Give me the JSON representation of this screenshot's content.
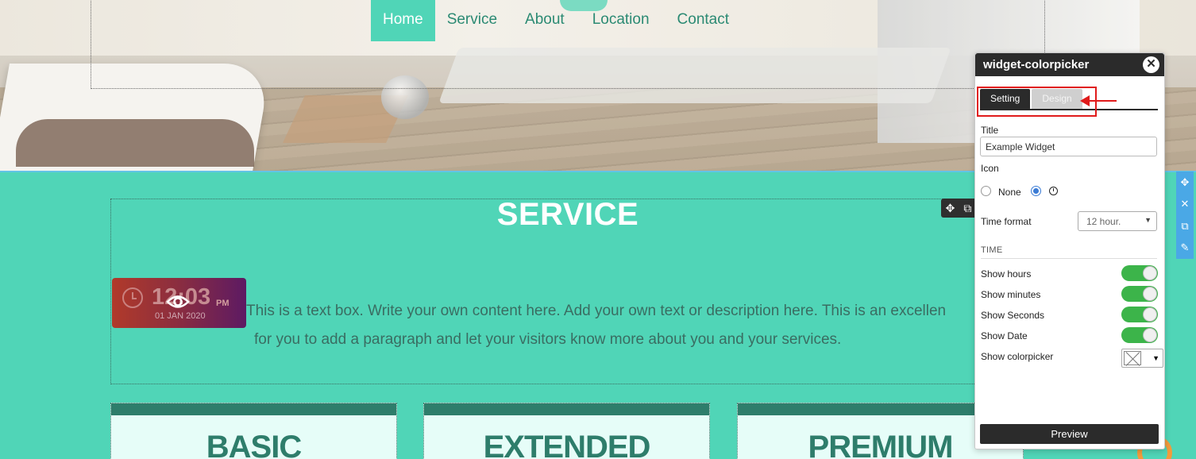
{
  "nav": {
    "items": [
      "Home",
      "Service",
      "About",
      "Location",
      "Contact"
    ],
    "active": "Home"
  },
  "service": {
    "title": "SERVICE",
    "text_line1": "This is a text box. Write your own content here. Add your own text or description here. This is an excellen",
    "text_line2": "for you to add a paragraph and let your visitors know more about you and your services."
  },
  "clock_widget": {
    "time": "12:03",
    "ampm": "PM",
    "date": "01 JAN 2020"
  },
  "cards": [
    {
      "name": "BASIC"
    },
    {
      "name": "EXTENDED"
    },
    {
      "name": "PREMIUM"
    }
  ],
  "panel": {
    "title": "widget-colorpicker",
    "close": "✕",
    "tabs": {
      "setting": "Setting",
      "design": "Design"
    },
    "title_label": "Title",
    "title_value": "Example Widget",
    "icon_label": "Icon",
    "icon_none": "None",
    "time_format_label": "Time format",
    "time_format_value": "12 hour.",
    "section_time": "TIME",
    "toggles": [
      {
        "label": "Show hours",
        "on": true
      },
      {
        "label": "Show minutes",
        "on": true
      },
      {
        "label": "Show Seconds",
        "on": true
      },
      {
        "label": "Show Date",
        "on": true
      }
    ],
    "colorpicker_label": "Show colorpicker",
    "preview": "Preview"
  },
  "colors": {
    "accent": "#50d5b7",
    "dark": "#2b2b2b",
    "highlight": "#e01b1b"
  }
}
